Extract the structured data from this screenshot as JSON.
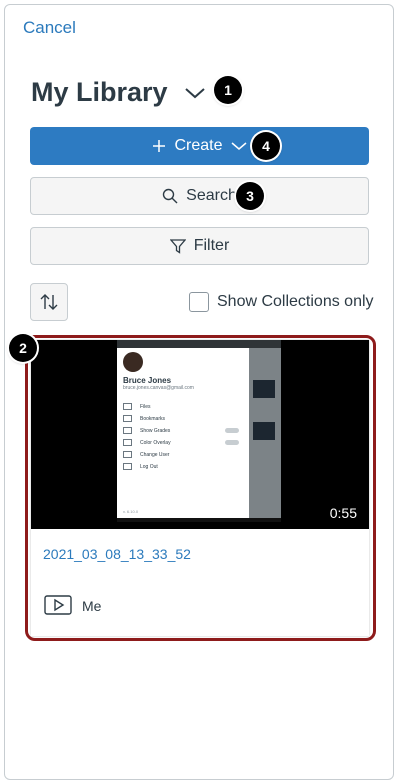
{
  "header": {
    "cancel_label": "Cancel",
    "title": "My Library"
  },
  "callouts": {
    "title_menu": "1",
    "media_card": "2",
    "search": "3",
    "create": "4"
  },
  "toolbar": {
    "create_label": "Create",
    "search_label": "Search",
    "filter_label": "Filter",
    "show_collections_label": "Show Collections only",
    "show_collections_checked": false
  },
  "media": [
    {
      "title": "2021_03_08_13_33_52",
      "duration": "0:55",
      "owner": "Me",
      "thumbnail": {
        "profile_name": "Bruce Jones",
        "profile_email": "bruce.jones.canvas@gmail.com",
        "menu_items": [
          "Files",
          "Bookmarks",
          "Show Grades",
          "Color Overlay",
          "Change User",
          "Log Out"
        ],
        "version": "v. 6.10.0"
      }
    }
  ],
  "colors": {
    "accent": "#2d7bc2",
    "link": "#2b7abc",
    "highlight": "#8e1b1b",
    "text": "#2d3b45"
  }
}
